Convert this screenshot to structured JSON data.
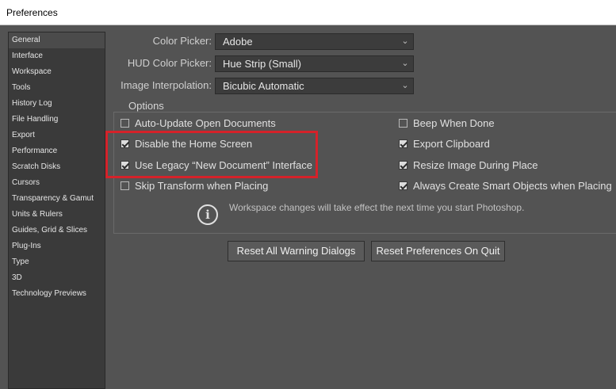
{
  "window": {
    "title": "Preferences"
  },
  "sidebar": {
    "items": [
      {
        "label": "General",
        "selected": true
      },
      {
        "label": "Interface"
      },
      {
        "label": "Workspace"
      },
      {
        "label": "Tools"
      },
      {
        "label": "History Log"
      },
      {
        "label": "File Handling"
      },
      {
        "label": "Export"
      },
      {
        "label": "Performance"
      },
      {
        "label": "Scratch Disks"
      },
      {
        "label": "Cursors"
      },
      {
        "label": "Transparency & Gamut"
      },
      {
        "label": "Units & Rulers"
      },
      {
        "label": "Guides, Grid & Slices"
      },
      {
        "label": "Plug-Ins"
      },
      {
        "label": "Type"
      },
      {
        "label": "3D"
      },
      {
        "label": "Technology Previews"
      }
    ]
  },
  "general": {
    "color_picker": {
      "label": "Color Picker:",
      "value": "Adobe"
    },
    "hud_color_picker": {
      "label": "HUD Color Picker:",
      "value": "Hue Strip (Small)"
    },
    "image_interpolation": {
      "label": "Image Interpolation:",
      "value": "Bicubic Automatic"
    }
  },
  "options": {
    "title": "Options",
    "left": [
      {
        "label": "Auto-Update Open Documents",
        "checked": false
      },
      {
        "label": "Disable the Home Screen",
        "checked": true
      },
      {
        "label": "Use Legacy “New Document” Interface",
        "checked": true
      },
      {
        "label": "Skip Transform when Placing",
        "checked": false
      }
    ],
    "right": [
      {
        "label": "Beep When Done",
        "checked": false
      },
      {
        "label": "Export Clipboard",
        "checked": true
      },
      {
        "label": "Resize Image During Place",
        "checked": true
      },
      {
        "label": "Always Create Smart Objects when Placing",
        "checked": true
      }
    ],
    "info_text": "Workspace changes will take effect the next time you start Photoshop."
  },
  "buttons": {
    "reset_warnings": "Reset All Warning Dialogs",
    "reset_prefs": "Reset Preferences On Quit"
  },
  "colors": {
    "highlight": "#d5222a",
    "background": "#535353",
    "sidebar": "#3a3a3a"
  },
  "icons": {
    "dropdown": "chevron-down-icon",
    "info": "info-icon"
  }
}
